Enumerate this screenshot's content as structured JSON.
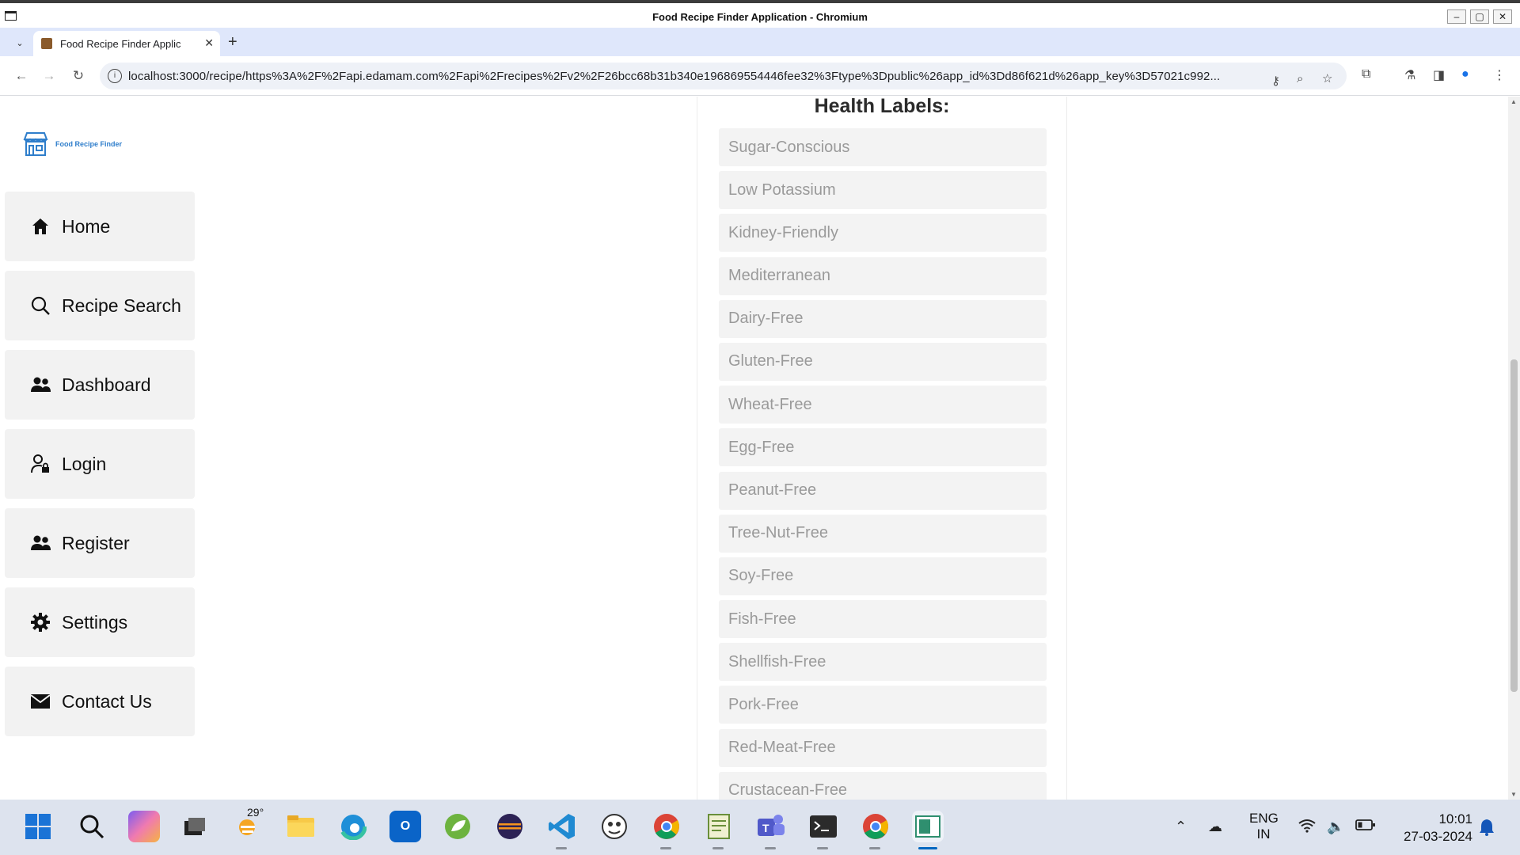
{
  "window": {
    "title": "Food Recipe Finder Application - Chromium",
    "minimize": "–",
    "maximize": "▢",
    "close": "✕"
  },
  "browser": {
    "tab_title": "Food Recipe Finder Applic",
    "tab_close": "✕",
    "new_tab": "+",
    "url": "localhost:3000/recipe/https%3A%2F%2Fapi.edamam.com%2Fapi%2Frecipes%2Fv2%2F26bcc68b31b340e196869554446fee32%3Ftype%3Dpublic%26app_id%3Dd86f621d%26app_key%3D57021c992..."
  },
  "app": {
    "brand_name": "Food Recipe Finder",
    "brand_color": "#2f7ecb",
    "nav": [
      {
        "label": "Home",
        "icon": "home-icon"
      },
      {
        "label": "Recipe Search",
        "icon": "search-icon"
      },
      {
        "label": "Dashboard",
        "icon": "users-icon"
      },
      {
        "label": "Login",
        "icon": "user-lock-icon"
      },
      {
        "label": "Register",
        "icon": "users-icon"
      },
      {
        "label": "Settings",
        "icon": "gear-icon"
      },
      {
        "label": "Contact Us",
        "icon": "mail-icon"
      }
    ],
    "health_labels_title": "Health Labels:",
    "health_labels": [
      "Sugar-Conscious",
      "Low Potassium",
      "Kidney-Friendly",
      "Mediterranean",
      "Dairy-Free",
      "Gluten-Free",
      "Wheat-Free",
      "Egg-Free",
      "Peanut-Free",
      "Tree-Nut-Free",
      "Soy-Free",
      "Fish-Free",
      "Shellfish-Free",
      "Pork-Free",
      "Red-Meat-Free",
      "Crustacean-Free"
    ]
  },
  "taskbar": {
    "weather_temp": "29°",
    "language_line1": "ENG",
    "language_line2": "IN",
    "time": "10:01",
    "date": "27-03-2024"
  }
}
